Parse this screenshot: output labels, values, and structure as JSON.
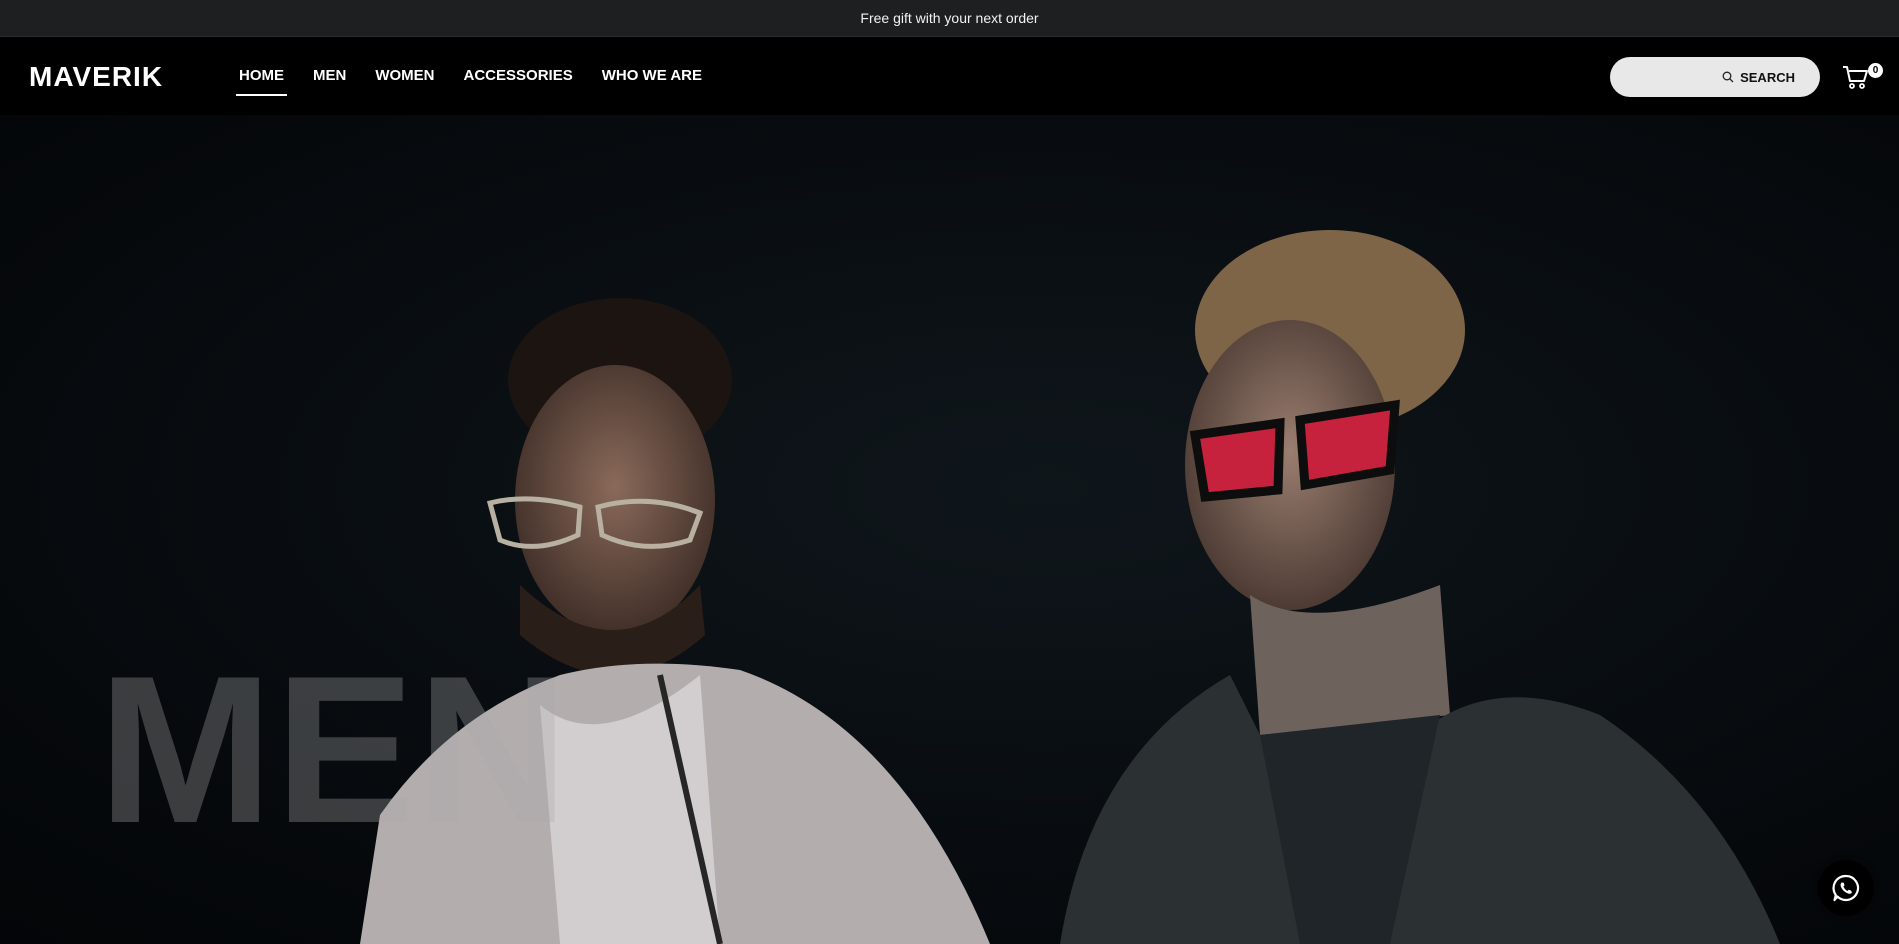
{
  "announcement": {
    "text": "Free gift with your next order"
  },
  "header": {
    "logo": "MAVERIK",
    "nav": [
      {
        "label": "HOME",
        "active": true
      },
      {
        "label": "MEN",
        "active": false
      },
      {
        "label": "WOMEN",
        "active": false
      },
      {
        "label": "ACCESSORIES",
        "active": false
      },
      {
        "label": "WHO WE ARE",
        "active": false
      }
    ],
    "search": {
      "label": "SEARCH",
      "placeholder": "",
      "icon": "search-icon"
    },
    "cart": {
      "count": "0",
      "icon": "cart-icon"
    }
  },
  "hero": {
    "title": "MEN"
  },
  "chat": {
    "icon": "whatsapp-icon"
  },
  "colors": {
    "background": "#000000",
    "announcement_bar": "#1d1f20",
    "search_bg": "#e8e8e8"
  }
}
